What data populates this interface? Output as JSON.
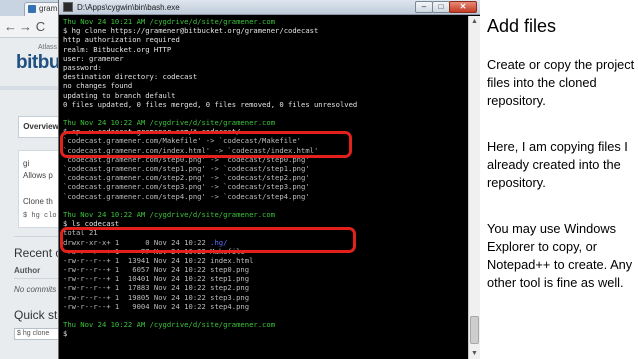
{
  "browser": {
    "tab_title": "gram",
    "nav": {
      "back": "←",
      "forward": "→",
      "reload": "C"
    },
    "logo_small": "Atlass",
    "logo_word": "bitbu",
    "overview_tab": "Overview",
    "card_lines": [
      "gi",
      "Allows p",
      "Clone th"
    ],
    "card_code": "$ hg clo",
    "recent_heading": "Recent c",
    "author_label": "Author",
    "no_commits_text": "No commits y",
    "quick_start_heading": "Quick star",
    "quick_input": "$ hg clone"
  },
  "terminal": {
    "title": "D:\\Apps\\cygwin\\bin\\bash.exe",
    "buttons": {
      "minimize": "–",
      "maximize": "□",
      "close": "✕"
    },
    "lines": [
      [
        {
          "t": "Thu Nov 24 10:21 AM /cygdrive/d/site/gramener.com",
          "c": "green"
        }
      ],
      [
        {
          "t": "$ hg clone https://gramener@bitbucket.org/gramener/codecast",
          "c": "white"
        }
      ],
      [
        {
          "t": "http authorization required",
          "c": "white"
        }
      ],
      [
        {
          "t": "realm: Bitbucket.org HTTP",
          "c": "white"
        }
      ],
      [
        {
          "t": "user: gramener",
          "c": "white"
        }
      ],
      [
        {
          "t": "password:",
          "c": "white"
        }
      ],
      [
        {
          "t": "destination directory: codecast",
          "c": "white"
        }
      ],
      [
        {
          "t": "no changes found",
          "c": "white"
        }
      ],
      [
        {
          "t": "updating to branch default",
          "c": "white"
        }
      ],
      [
        {
          "t": "0 files updated, 0 files merged, 0 files removed, 0 files unresolved",
          "c": "white"
        }
      ],
      [
        {
          "t": "",
          "c": "white"
        }
      ],
      [
        {
          "t": "Thu Nov 24 10:22 AM /cygdrive/d/site/gramener.com",
          "c": "green"
        }
      ],
      [
        {
          "t": "$ cp -v codecast.gramener.com/* codecast/",
          "c": "white"
        }
      ],
      [
        {
          "t": "`codecast.gramener.com/Makefile' -> `codecast/Makefile'",
          "c": "grey"
        }
      ],
      [
        {
          "t": "`codecast.gramener.com/index.html' -> `codecast/index.html'",
          "c": "grey"
        }
      ],
      [
        {
          "t": "`codecast.gramener.com/step0.png' -> `codecast/step0.png'",
          "c": "grey"
        }
      ],
      [
        {
          "t": "`codecast.gramener.com/step1.png' -> `codecast/step1.png'",
          "c": "grey"
        }
      ],
      [
        {
          "t": "`codecast.gramener.com/step2.png' -> `codecast/step2.png'",
          "c": "grey"
        }
      ],
      [
        {
          "t": "`codecast.gramener.com/step3.png' -> `codecast/step3.png'",
          "c": "grey"
        }
      ],
      [
        {
          "t": "`codecast.gramener.com/step4.png' -> `codecast/step4.png'",
          "c": "grey"
        }
      ],
      [
        {
          "t": "",
          "c": "white"
        }
      ],
      [
        {
          "t": "Thu Nov 24 10:22 AM /cygdrive/d/site/gramener.com",
          "c": "green"
        }
      ],
      [
        {
          "t": "$ ls codecast",
          "c": "white"
        }
      ],
      [
        {
          "t": "total 21",
          "c": "grey"
        }
      ],
      [
        {
          "t": "drwxr-xr-x+ 1      0 Nov 24 10:22 ",
          "c": "grey"
        },
        {
          "t": ".hg/",
          "c": "blue"
        }
      ],
      [
        {
          "t": "-rw-r--r--+ 1     77 Nov 24 10:22 Makefile",
          "c": "grey"
        }
      ],
      [
        {
          "t": "-rw-r--r--+ 1  13941 Nov 24 10:22 index.html",
          "c": "grey"
        }
      ],
      [
        {
          "t": "-rw-r--r--+ 1   6057 Nov 24 10:22 step0.png",
          "c": "grey"
        }
      ],
      [
        {
          "t": "-rw-r--r--+ 1  10401 Nov 24 10:22 step1.png",
          "c": "grey"
        }
      ],
      [
        {
          "t": "-rw-r--r--+ 1  17883 Nov 24 10:22 step2.png",
          "c": "grey"
        }
      ],
      [
        {
          "t": "-rw-r--r--+ 1  19805 Nov 24 10:22 step3.png",
          "c": "grey"
        }
      ],
      [
        {
          "t": "-rw-r--r--+ 1   9004 Nov 24 10:22 step4.png",
          "c": "grey"
        }
      ],
      [
        {
          "t": "",
          "c": "white"
        }
      ],
      [
        {
          "t": "Thu Nov 24 10:22 AM /cygdrive/d/site/gramener.com",
          "c": "green"
        }
      ],
      [
        {
          "t": "$ ",
          "c": "white"
        }
      ]
    ]
  },
  "highlight_color": "#e2211c",
  "terminal_colors": {
    "green": "#3cc43c",
    "white": "#e4e4e4",
    "grey": "#bdbdbd",
    "blue": "#5c6cff",
    "background": "#000000"
  },
  "panel": {
    "title": "Add files",
    "paragraphs": [
      "Create or copy the project files into the cloned repository.",
      "Here, I am copying files I already created into the repository.",
      "You may use Windows Explorer to copy, or Notepad++ to create. Any other tool is fine as well."
    ]
  }
}
